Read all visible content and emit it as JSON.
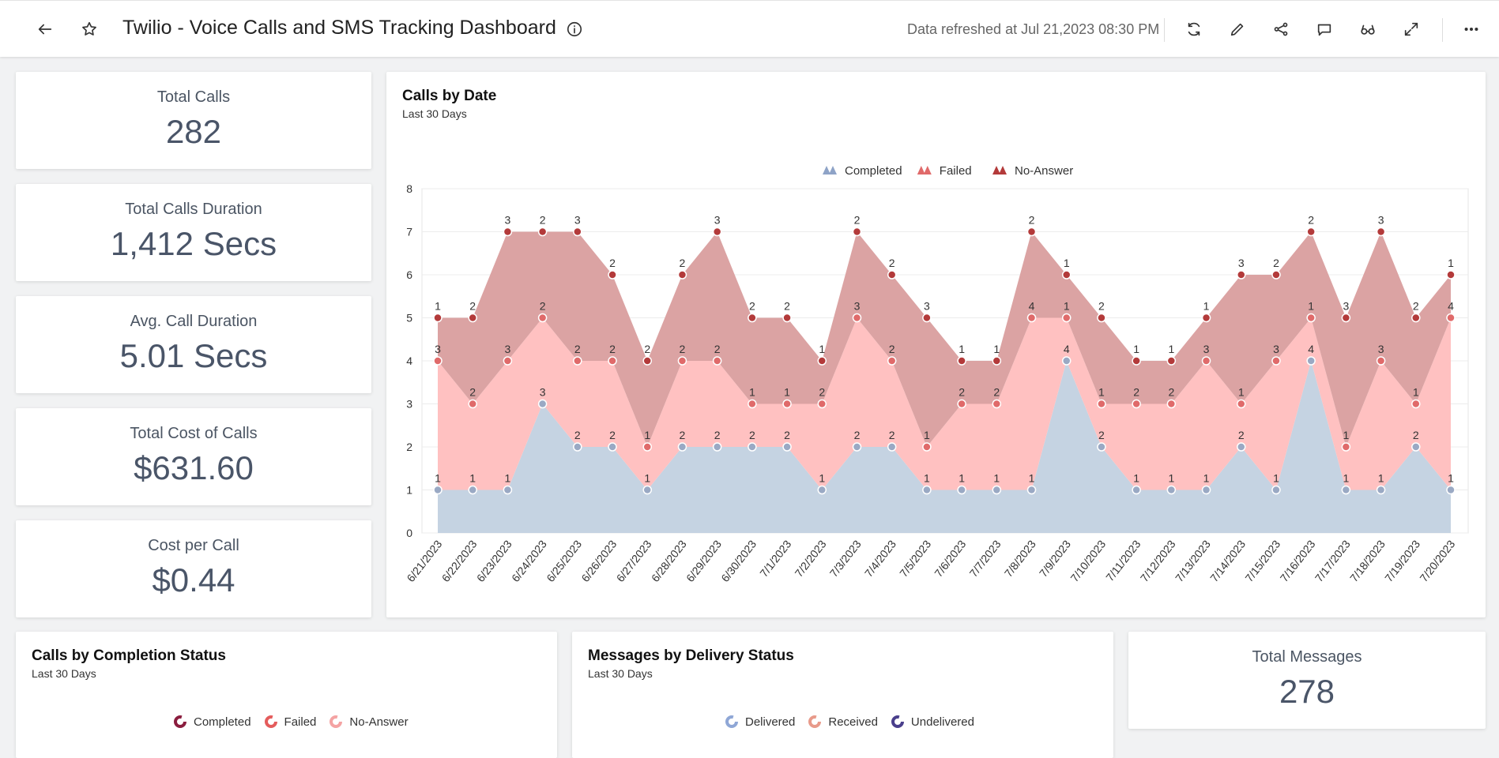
{
  "header": {
    "title": "Twilio - Voice Calls and SMS Tracking Dashboard",
    "refreshed": "Data refreshed at Jul 21,2023 08:30 PM",
    "icons": [
      "back-arrow-icon",
      "star-icon",
      "info-icon",
      "refresh-icon",
      "edit-icon",
      "share-icon",
      "comment-icon",
      "glasses-icon",
      "expand-icon",
      "more-icon"
    ]
  },
  "kpis": [
    {
      "label": "Total Calls",
      "value": "282"
    },
    {
      "label": "Total Calls Duration",
      "value": "1,412 Secs"
    },
    {
      "label": "Avg. Call Duration",
      "value": "5.01 Secs"
    },
    {
      "label": "Total Cost of Calls",
      "value": "$631.60"
    },
    {
      "label": "Cost per Call",
      "value": "$0.44"
    }
  ],
  "calls_by_date": {
    "title": "Calls by Date",
    "subtitle": "Last 30 Days"
  },
  "completion_status": {
    "title": "Calls by Completion Status",
    "subtitle": "Last 30 Days",
    "legend": [
      {
        "name": "Completed",
        "color": "#8b1e3f"
      },
      {
        "name": "Failed",
        "color": "#e45c5c"
      },
      {
        "name": "No-Answer",
        "color": "#f4a3a3"
      }
    ]
  },
  "messages_status": {
    "title": "Messages by Delivery Status",
    "subtitle": "Last 30 Days",
    "legend": [
      {
        "name": "Delivered",
        "color": "#8fa7d6"
      },
      {
        "name": "Received",
        "color": "#e89a8a"
      },
      {
        "name": "Undelivered",
        "color": "#4a3f8c"
      }
    ]
  },
  "total_messages": {
    "label": "Total Messages",
    "value": "278"
  },
  "chart_data": {
    "type": "area",
    "stacked": true,
    "title": "Calls by Date",
    "subtitle": "Last 30 Days",
    "xlabel": "",
    "ylabel": "",
    "ylim": [
      0,
      8
    ],
    "yticks": [
      0,
      1,
      2,
      3,
      4,
      5,
      6,
      7,
      8
    ],
    "grid": true,
    "legend_position": "top-center",
    "categories": [
      "6/21/2023",
      "6/22/2023",
      "6/23/2023",
      "6/24/2023",
      "6/25/2023",
      "6/26/2023",
      "6/27/2023",
      "6/28/2023",
      "6/29/2023",
      "6/30/2023",
      "7/1/2023",
      "7/2/2023",
      "7/3/2023",
      "7/4/2023",
      "7/5/2023",
      "7/6/2023",
      "7/7/2023",
      "7/8/2023",
      "7/9/2023",
      "7/10/2023",
      "7/11/2023",
      "7/12/2023",
      "7/13/2023",
      "7/14/2023",
      "7/15/2023",
      "7/16/2023",
      "7/17/2023",
      "7/18/2023",
      "7/19/2023",
      "7/20/2023"
    ],
    "series": [
      {
        "name": "Completed",
        "color": "#c5d3e2",
        "marker": "#9aa9c4",
        "values": [
          1,
          1,
          1,
          3,
          2,
          2,
          1,
          2,
          2,
          2,
          2,
          1,
          2,
          2,
          1,
          1,
          1,
          1,
          4,
          2,
          1,
          1,
          1,
          2,
          1,
          4,
          1,
          1,
          2,
          1
        ]
      },
      {
        "name": "Failed",
        "color": "#ffc1c1",
        "marker": "#e06a6a",
        "values": [
          3,
          2,
          3,
          2,
          2,
          2,
          1,
          2,
          2,
          1,
          1,
          2,
          3,
          2,
          1,
          2,
          2,
          4,
          1,
          1,
          2,
          2,
          3,
          1,
          3,
          1,
          1,
          3,
          1,
          4
        ]
      },
      {
        "name": "No-Answer",
        "color": "#dba3a3",
        "marker": "#b33a3a",
        "values": [
          1,
          2,
          3,
          2,
          3,
          2,
          2,
          2,
          3,
          2,
          2,
          1,
          2,
          2,
          3,
          1,
          1,
          2,
          1,
          2,
          1,
          1,
          1,
          3,
          2,
          2,
          3,
          3,
          2,
          1
        ]
      }
    ]
  }
}
